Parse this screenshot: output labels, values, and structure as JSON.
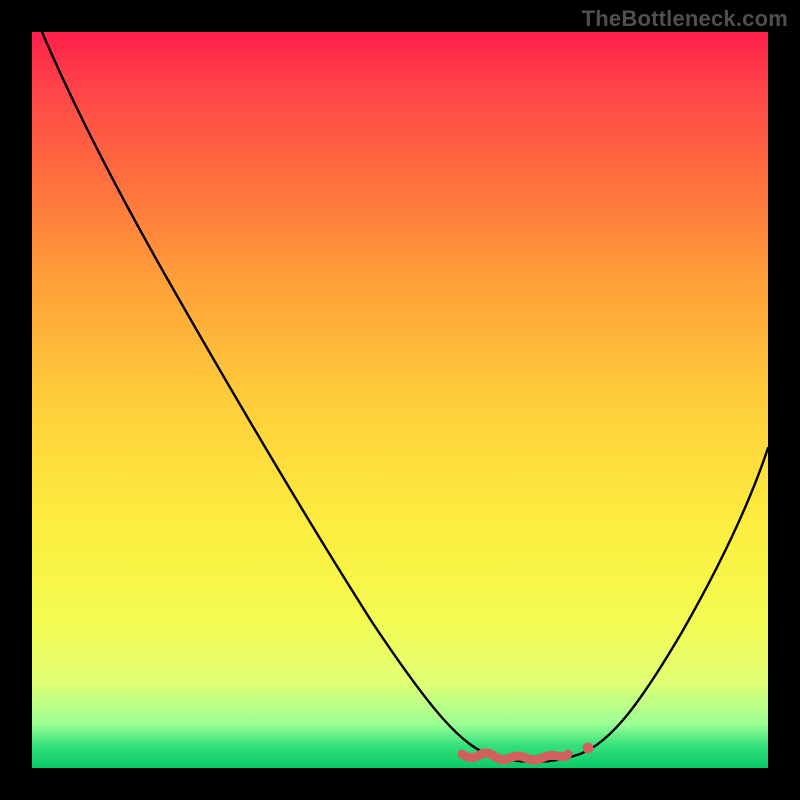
{
  "watermark": "TheBottleneck.com",
  "colors": {
    "background": "#000000",
    "curve": "#000000",
    "highlight": "#d2615e"
  },
  "chart_data": {
    "type": "line",
    "title": "",
    "xlabel": "",
    "ylabel": "",
    "xlim": [
      0,
      100
    ],
    "ylim": [
      0,
      100
    ],
    "grid": false,
    "legend": false,
    "x": [
      0,
      5,
      10,
      15,
      20,
      25,
      30,
      35,
      40,
      45,
      50,
      55,
      58,
      60,
      62,
      65,
      68,
      70,
      72,
      75,
      80,
      85,
      90,
      95,
      100
    ],
    "y": [
      100,
      92,
      84,
      76,
      68,
      60,
      52,
      44,
      36,
      28,
      20,
      12,
      7,
      4,
      2,
      1,
      1,
      1,
      2,
      4,
      10,
      18,
      28,
      39,
      52
    ],
    "note": "V-shaped bottleneck curve. Minimum plateau roughly between x=62 and x=72 at y≈1. Values are read from the plotted black curve against the full-plot coordinate system; the image has no numeric axis labels so values are normalized 0–100.",
    "highlight_region": {
      "x_start": 58,
      "x_end": 74,
      "y": 1
    }
  }
}
